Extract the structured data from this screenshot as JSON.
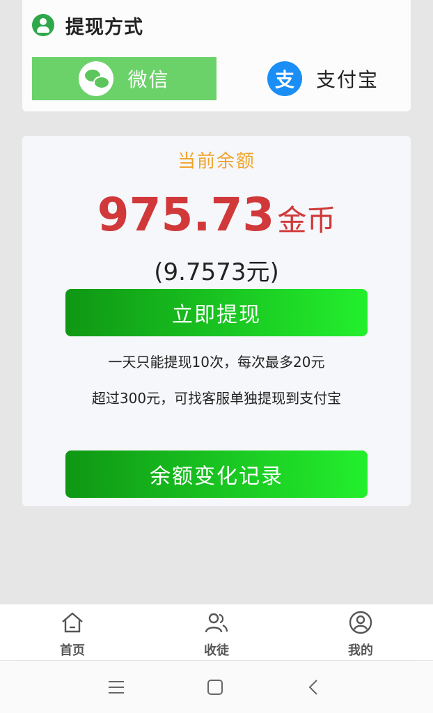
{
  "withdraw_method": {
    "title": "提现方式",
    "options": {
      "wechat": "微信",
      "alipay": "支付宝",
      "alipay_icon_glyph": "支"
    }
  },
  "balance": {
    "label": "当前余额",
    "amount": "975.73",
    "unit": "金币",
    "yuan": "(9.7573元)",
    "withdraw_button": "立即提现",
    "note_1": "一天只能提现10次，每次最多20元",
    "note_2": "超过300元，可找客服单独提现到支付宝",
    "records_button": "余额变化记录"
  },
  "tabs": {
    "home": "首页",
    "apprentices": "收徒",
    "mine": "我的"
  },
  "icons": {
    "user": "user-icon",
    "wechat": "wechat-icon",
    "alipay": "alipay-icon",
    "home": "home-icon",
    "apprentices": "people-icon",
    "mine": "person-circle-icon",
    "nav_menu": "menu-icon",
    "nav_home": "square-icon",
    "nav_back": "back-chevron-icon"
  },
  "colors": {
    "accent_green": "#23ef2d",
    "dark_green": "#0f9714",
    "wechat_bg": "#6bd26a",
    "alipay_blue": "#1a8ef5",
    "balance_red": "#d0383a",
    "label_orange": "#f0a42c"
  }
}
